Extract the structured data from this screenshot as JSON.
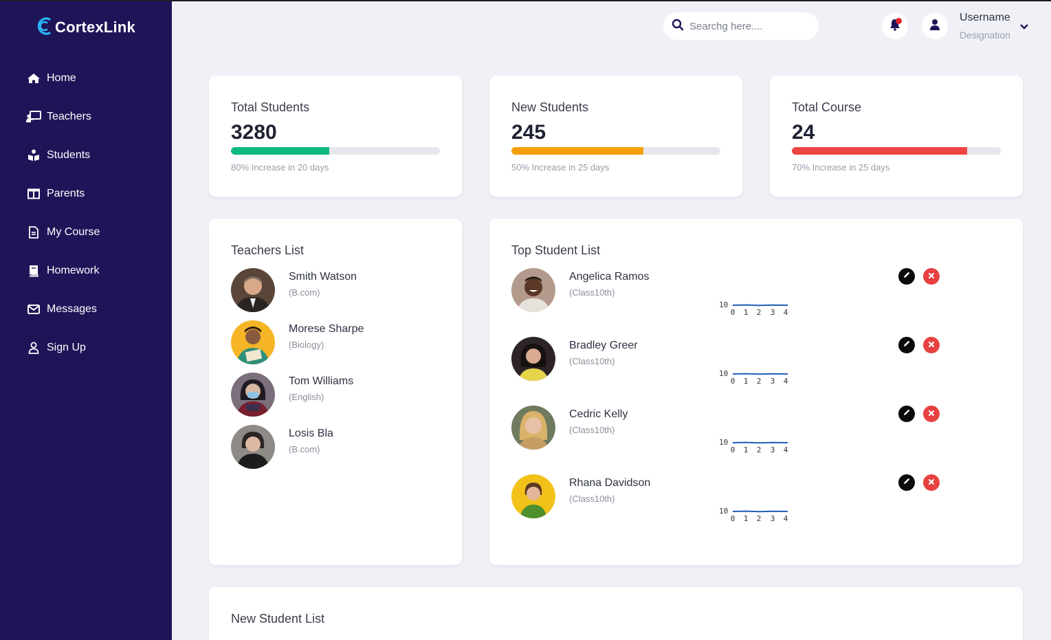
{
  "app": {
    "brand": "CortexLink"
  },
  "sidebar": {
    "items": [
      {
        "label": "Home",
        "icon": "home-icon"
      },
      {
        "label": "Teachers",
        "icon": "teacher-board-icon"
      },
      {
        "label": "Students",
        "icon": "students-icon"
      },
      {
        "label": "Parents",
        "icon": "parents-icon"
      },
      {
        "label": "My Course",
        "icon": "document-icon"
      },
      {
        "label": "Homework",
        "icon": "book-icon"
      },
      {
        "label": "Messages",
        "icon": "envelope-icon"
      },
      {
        "label": "Sign Up",
        "icon": "user-icon"
      }
    ]
  },
  "header": {
    "search_placeholder": "Searchg here....",
    "user_name": "Username",
    "user_designation": "Designation"
  },
  "stats": [
    {
      "title": "Total Students",
      "value": "3280",
      "note": "80% Increase in 20 days",
      "progress": 0.47,
      "color": "#10b981"
    },
    {
      "title": "New Students",
      "value": "245",
      "note": "50% Increase in 25 days",
      "progress": 0.63,
      "color": "#f59e0b"
    },
    {
      "title": "Total Course",
      "value": "24",
      "note": "70% Increase in 25 days",
      "progress": 0.84,
      "color": "#ef4444"
    }
  ],
  "teachers": {
    "title": "Teachers List",
    "items": [
      {
        "name": "Smith Watson",
        "subject": "(B.com)"
      },
      {
        "name": "Morese Sharpe",
        "subject": "(Biology)"
      },
      {
        "name": "Tom Williams",
        "subject": "(English)"
      },
      {
        "name": "Losis Bla",
        "subject": "(B.com)"
      }
    ]
  },
  "top_students": {
    "title": "Top Student List",
    "items": [
      {
        "name": "Angelica Ramos",
        "class": "(Class10th)"
      },
      {
        "name": "Bradley Greer",
        "class": "(Class10th)"
      },
      {
        "name": "Cedric Kelly",
        "class": "(Class10th)"
      },
      {
        "name": "Rhana Davidson",
        "class": "(Class10th)"
      }
    ],
    "sparkline": {
      "y_tick": "10",
      "x_ticks": [
        "0",
        "1",
        "2",
        "3",
        "4"
      ]
    }
  },
  "new_students": {
    "title": "New Student List"
  }
}
